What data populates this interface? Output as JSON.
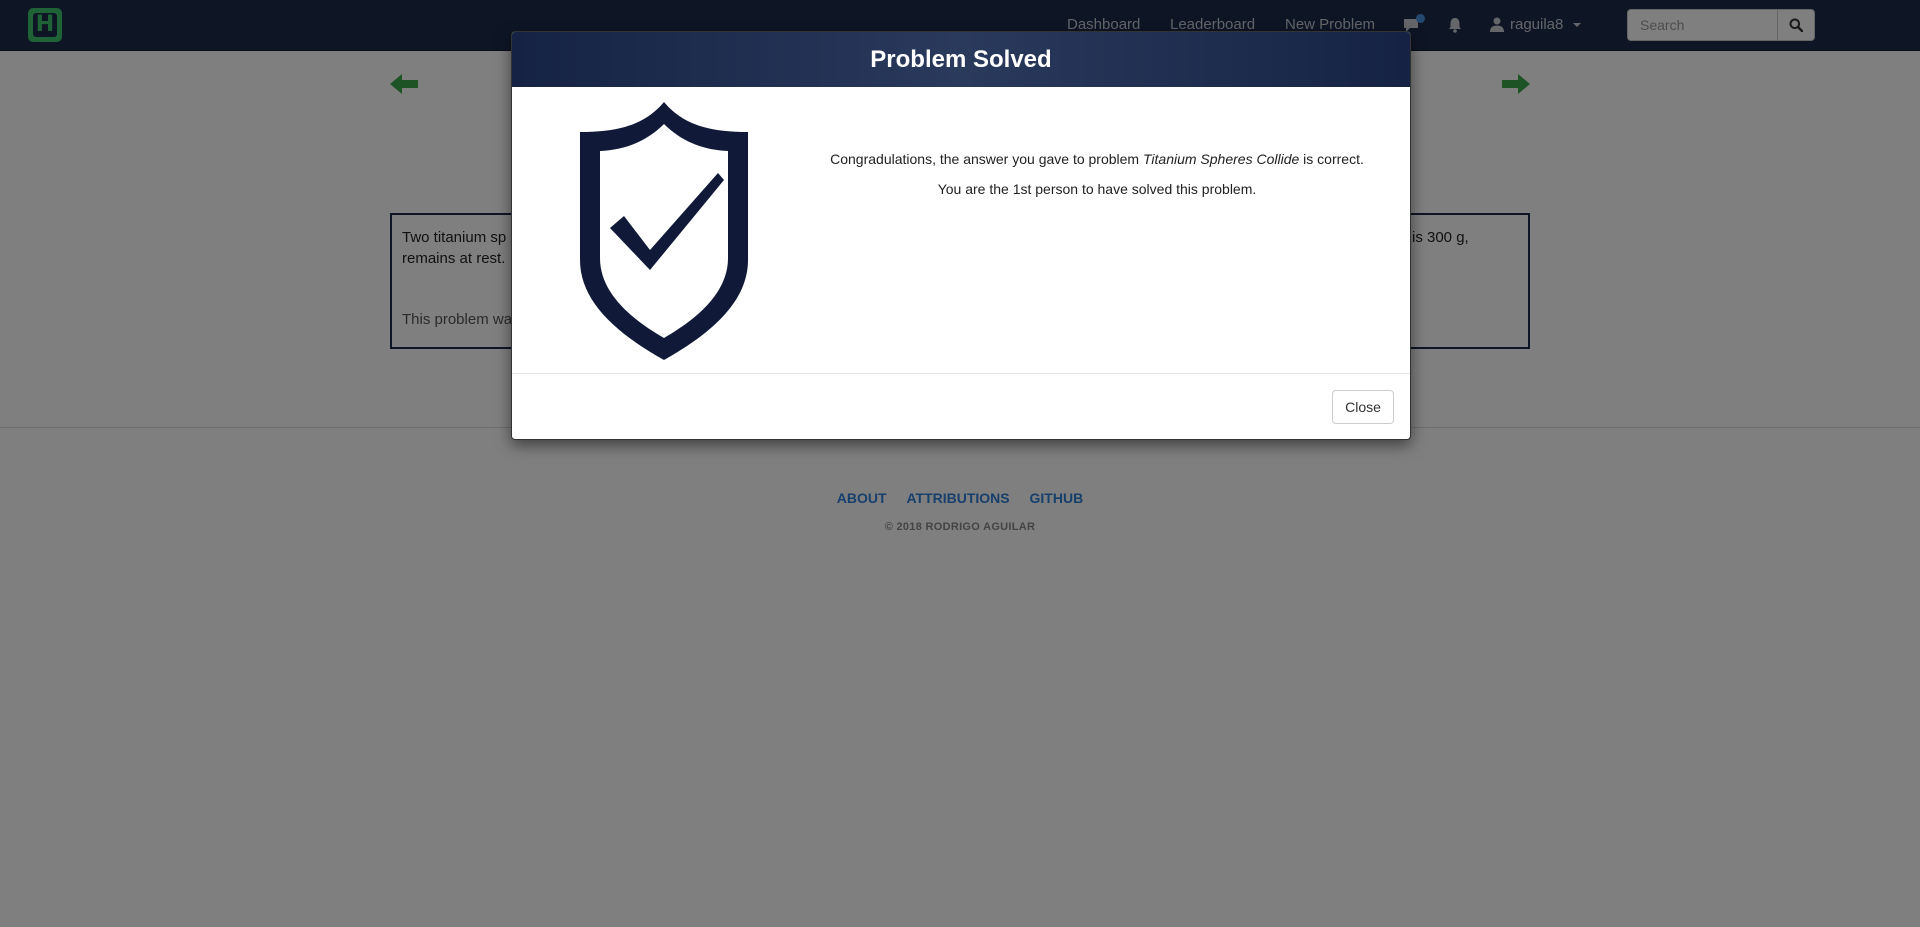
{
  "navbar": {
    "brand_letter": "H",
    "links": {
      "dashboard": "Dashboard",
      "leaderboard": "Leaderboard",
      "new_problem": "New Problem"
    },
    "icons": {
      "chat": "chat-icon",
      "bell": "bell-icon",
      "user": "user-icon",
      "search": "search-icon"
    },
    "username": "raguila8",
    "search_placeholder": "Search"
  },
  "problem": {
    "text_left_line1": "Two titanium sp",
    "text_left_line2": "remains at rest.",
    "text_right_line1": "is 300 g,",
    "credit_fragment": "This problem wa"
  },
  "footer": {
    "about": "ABOUT",
    "attributions": "ATTRIBUTIONS",
    "github": "GITHUB",
    "copyright": "© 2018 RODRIGO AGUILAR"
  },
  "modal": {
    "title": "Problem Solved",
    "message_prefix": "Congradulations, the answer you gave to problem ",
    "problem_name": "Titanium Spheres Collide",
    "message_suffix": " is correct.",
    "rank_message": "You are the 1st person to have solved this problem.",
    "close_label": "Close",
    "icon": "shield-check-icon"
  },
  "colors": {
    "navbar": "#1c2a4a",
    "brand_green": "#3ec46d",
    "arrow_green": "#3aa64a",
    "shield": "#101a38",
    "link_blue": "#2f7ed8"
  }
}
